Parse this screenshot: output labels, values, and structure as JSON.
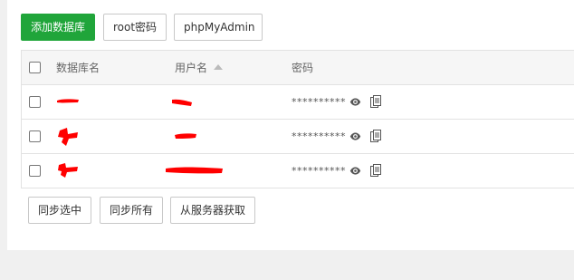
{
  "toolbar": {
    "add_db_label": "添加数据库",
    "root_pwd_label": "root密码",
    "phpmyadmin_label": "phpMyAdmin"
  },
  "table": {
    "columns": {
      "db_name": "数据库名",
      "username": "用户名",
      "password": "密码"
    },
    "sort_column": "username",
    "rows": [
      {
        "db_name": "",
        "username": "",
        "password": "**********",
        "redacted": true
      },
      {
        "db_name": "",
        "username": "",
        "password": "**********",
        "redacted": true
      },
      {
        "db_name": "",
        "username": "",
        "password": "**********",
        "redacted": true
      }
    ]
  },
  "footer": {
    "sync_selected_label": "同步选中",
    "sync_all_label": "同步所有",
    "fetch_from_server_label": "从服务器获取"
  },
  "icons": {
    "show_password": "eye-icon",
    "copy_password": "copy-icon",
    "sort": "sort-up-icon"
  },
  "colors": {
    "primary": "#20a53a",
    "redaction": "#ff0000"
  }
}
